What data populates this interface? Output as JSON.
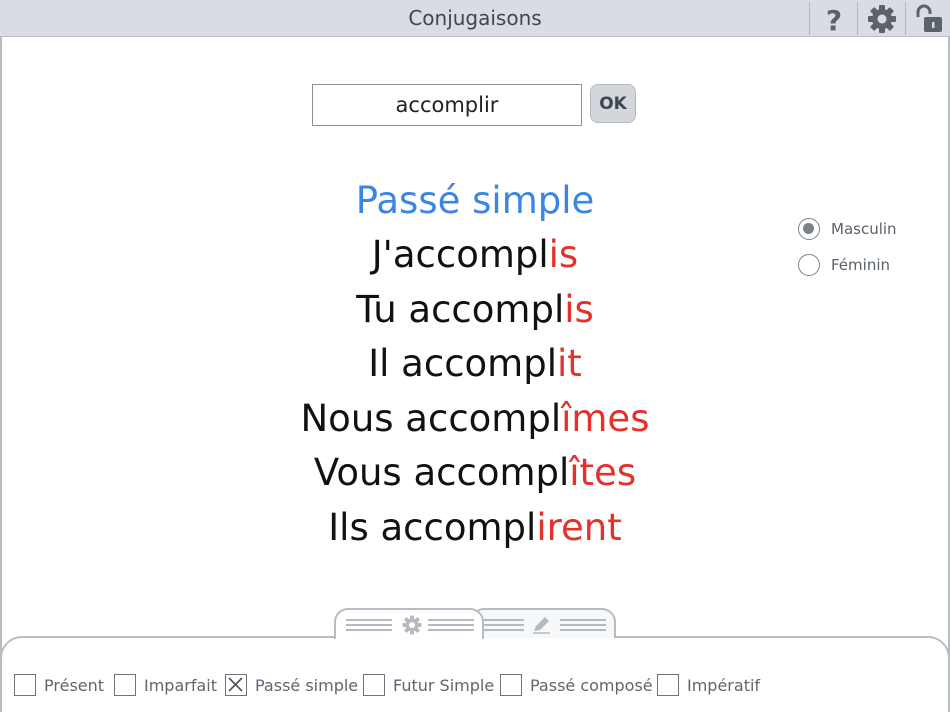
{
  "window": {
    "title": "Conjugaisons"
  },
  "toolbar": {
    "help_icon": "help-icon",
    "settings_icon": "gear-icon",
    "lock_icon": "unlocked-padlock-icon"
  },
  "verb_entry": {
    "value": "accomplir",
    "ok_label": "OK"
  },
  "conjugation": {
    "tense": "Passé simple",
    "lines": [
      {
        "stem": "J'accompl",
        "ending": "is"
      },
      {
        "stem": "Tu accompl",
        "ending": "is"
      },
      {
        "stem": "Il accompl",
        "ending": "it"
      },
      {
        "stem": "Nous accompl",
        "ending": "îmes"
      },
      {
        "stem": "Vous accompl",
        "ending": "îtes"
      },
      {
        "stem": "Ils accompl",
        "ending": "irent"
      }
    ]
  },
  "gender": {
    "options": [
      {
        "label": "Masculin",
        "selected": true
      },
      {
        "label": "Féminin",
        "selected": false
      }
    ]
  },
  "bottom_tabs": [
    {
      "icon": "gear-icon",
      "active": true
    },
    {
      "icon": "pencil-icon",
      "active": false
    }
  ],
  "tenses": [
    {
      "label": "Présent",
      "checked": false
    },
    {
      "label": "Imparfait",
      "checked": false
    },
    {
      "label": "Passé simple",
      "checked": true
    },
    {
      "label": "Futur Simple",
      "checked": false
    },
    {
      "label": "Passé composé",
      "checked": false
    },
    {
      "label": "Impératif",
      "checked": false
    }
  ],
  "colors": {
    "accent": "#3d85e3",
    "ending": "#e2322b",
    "chrome": "#d9dde3"
  }
}
